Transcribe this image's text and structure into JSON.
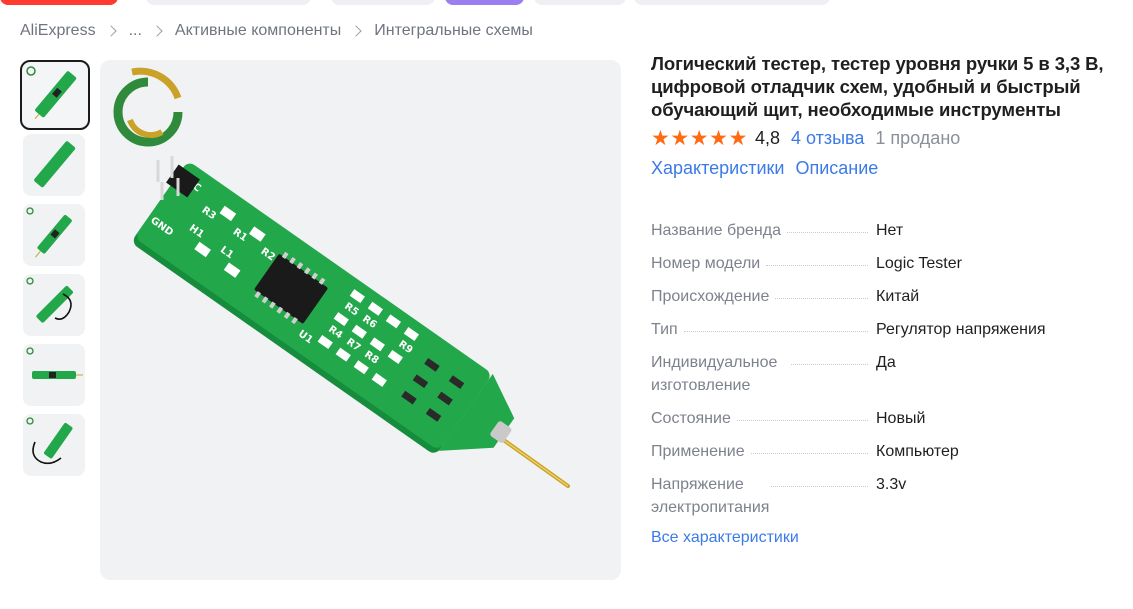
{
  "breadcrumb": {
    "items": [
      "AliExpress",
      "...",
      "Активные компоненты",
      "Интегральные схемы"
    ]
  },
  "thumbnails": {
    "count": 6,
    "active_index": 0
  },
  "product": {
    "title": "Логический тестер, тестер уровня ручки 5 в 3,3 В, цифровой отладчик схем, удобный и быстрый обучающий щит, необходимые инструменты",
    "rating": "4,8",
    "stars": 5,
    "reviews": "4 отзыва",
    "sold": "1 продано",
    "tabs": [
      "Характеристики",
      "Описание"
    ]
  },
  "specs": [
    {
      "key": "Название бренда",
      "value": "Нет"
    },
    {
      "key": "Номер модели",
      "value": "Logic Tester"
    },
    {
      "key": "Происхождение",
      "value": "Китай"
    },
    {
      "key": "Тип",
      "value": "Регулятор напряжения"
    },
    {
      "key": "Индивидуальное изготовление",
      "value": "Да"
    },
    {
      "key": "Состояние",
      "value": "Новый"
    },
    {
      "key": "Применение",
      "value": "Компьютер"
    },
    {
      "key": "Напряжение электропитания",
      "value": "3.3v"
    }
  ],
  "all_specs_link": "Все характеристики",
  "colors": {
    "accent_link": "#3b7ae8",
    "star": "#ff6a13",
    "pcb_green": "#1fa84a"
  },
  "pcb_labels": {
    "vcc": "VCC",
    "gnd": "GND",
    "r3": "R3",
    "r1": "R1",
    "r2": "R2",
    "h1": "H1",
    "l1": "L1",
    "u1": "U1",
    "r5": "R5",
    "r6": "R6",
    "r4": "R4",
    "r7": "R7",
    "r8": "R8",
    "r9": "R9"
  }
}
